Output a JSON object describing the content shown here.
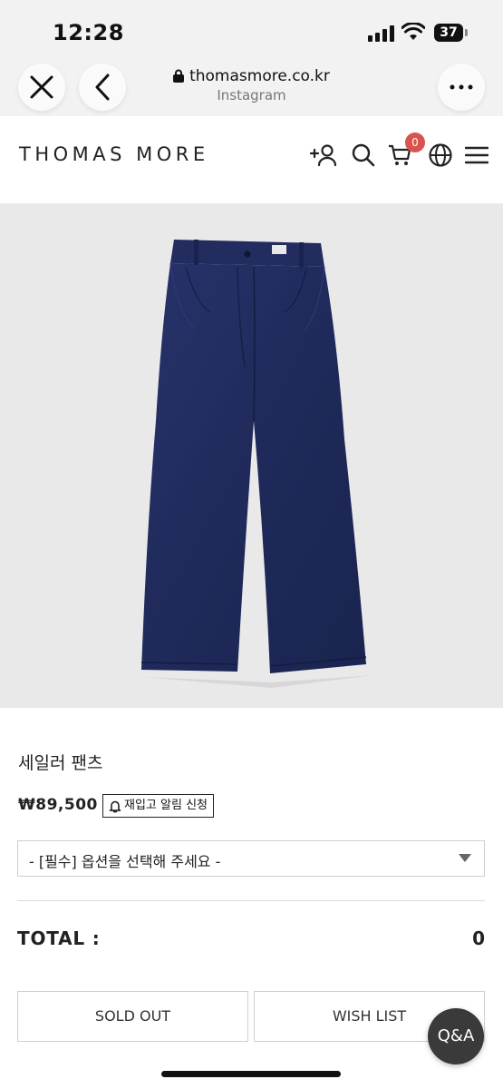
{
  "status_bar": {
    "time": "12:28",
    "battery": "37"
  },
  "browser": {
    "url": "thomasmore.co.kr",
    "source": "Instagram"
  },
  "site": {
    "logo": "THOMAS MORE",
    "cart_count": "0",
    "icons": [
      "add-user-icon",
      "search-icon",
      "cart-icon",
      "globe-icon",
      "menu-icon"
    ]
  },
  "product": {
    "name": "세일러 팬츠",
    "price": "₩89,500",
    "restock_label": "재입고 알림 신청",
    "option_placeholder": "- [필수] 옵션을 선택해 주세요 -",
    "total_label": "TOTAL :",
    "total_value": "0",
    "soldout_label": "SOLD OUT",
    "wishlist_label": "WISH LIST",
    "image_color": "#1f2a5a"
  },
  "qa_label": "Q&A"
}
